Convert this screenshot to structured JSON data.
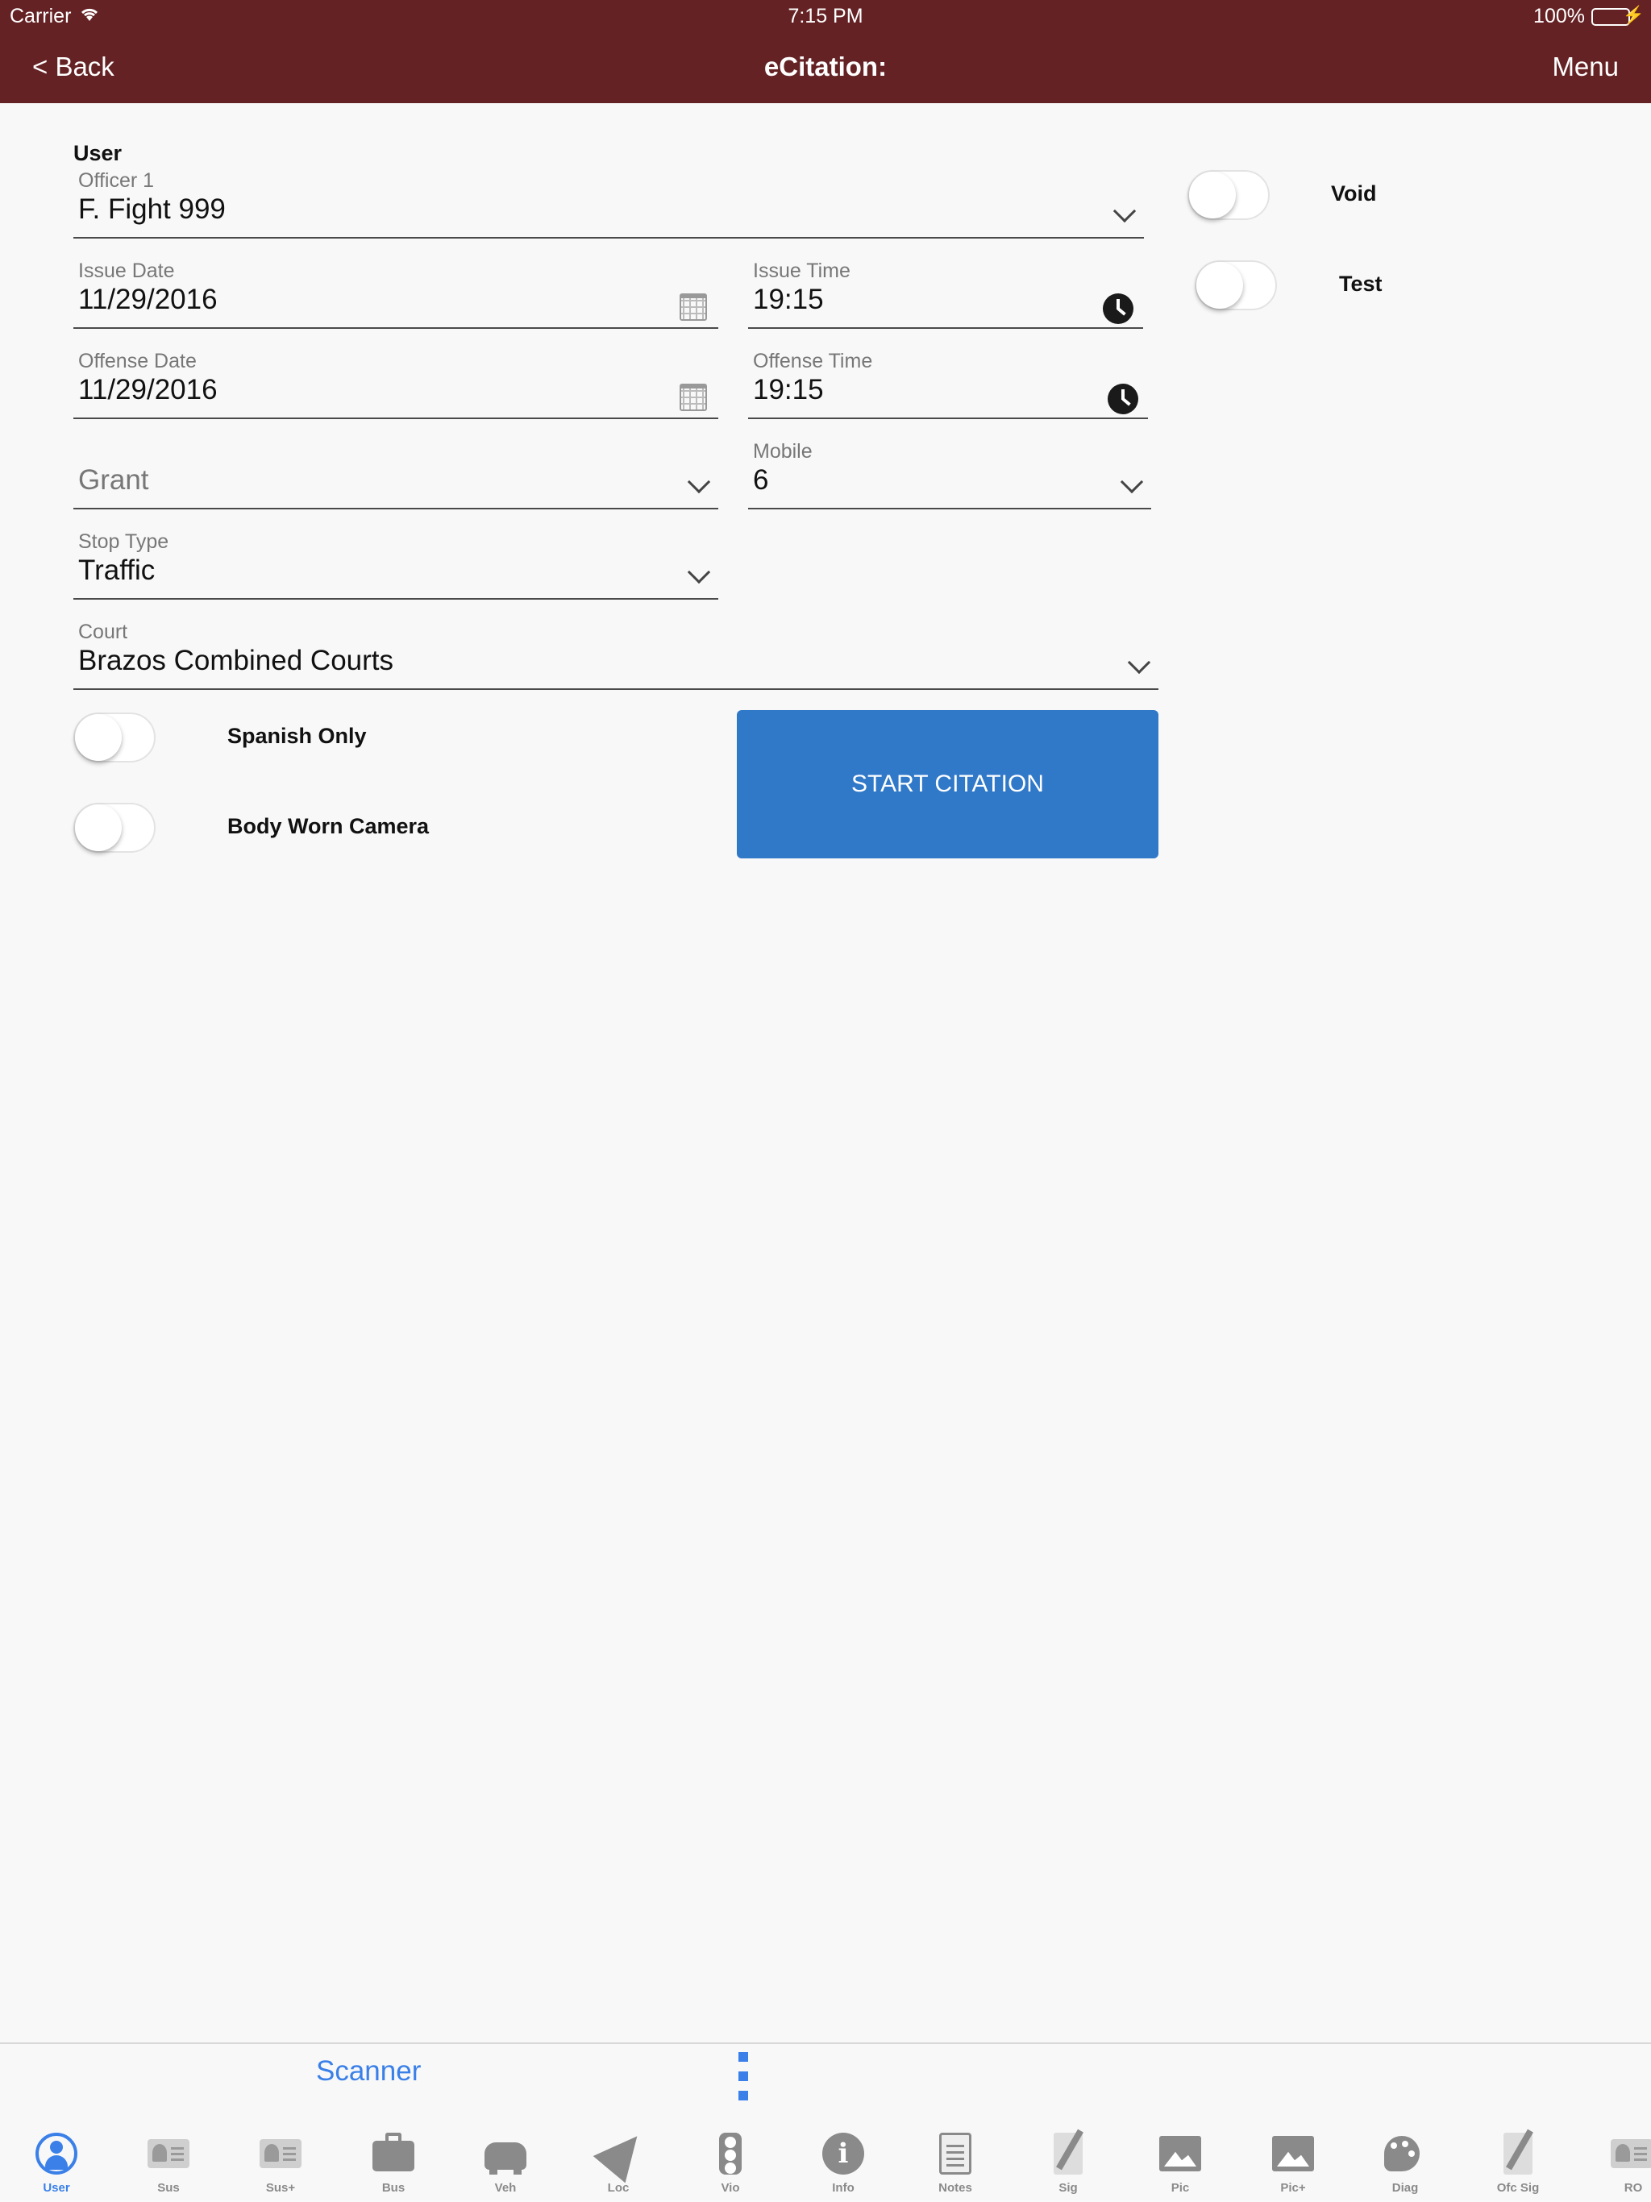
{
  "status_bar": {
    "carrier": "Carrier",
    "time": "7:15 PM",
    "battery": "100%"
  },
  "nav": {
    "back": "< Back",
    "title": "eCitation:",
    "menu": "Menu"
  },
  "form": {
    "section_title": "User",
    "officer": {
      "label": "Officer 1",
      "value": "F. Fight 999"
    },
    "issue_date": {
      "label": "Issue Date",
      "value": "11/29/2016"
    },
    "issue_time": {
      "label": "Issue Time",
      "value": "19:15"
    },
    "offense_date": {
      "label": "Offense Date",
      "value": "11/29/2016"
    },
    "offense_time": {
      "label": "Offense Time",
      "value": "19:15"
    },
    "grant": {
      "placeholder": "Grant"
    },
    "mobile": {
      "label": "Mobile",
      "value": "6"
    },
    "stop_type": {
      "label": "Stop Type",
      "value": "Traffic"
    },
    "court": {
      "label": "Court",
      "value": "Brazos Combined Courts"
    }
  },
  "toggles": {
    "void": {
      "label": "Void",
      "on": false
    },
    "test": {
      "label": "Test",
      "on": false
    },
    "spanish_only": {
      "label": "Spanish Only",
      "on": false
    },
    "body_worn_camera": {
      "label": "Body Worn Camera",
      "on": false
    }
  },
  "start_button": "START CITATION",
  "scanner": "Scanner",
  "tabs": [
    {
      "label": "User",
      "icon": "user-icon",
      "active": true
    },
    {
      "label": "Sus",
      "icon": "id-card-icon"
    },
    {
      "label": "Sus+",
      "icon": "id-card-icon"
    },
    {
      "label": "Bus",
      "icon": "briefcase-icon"
    },
    {
      "label": "Veh",
      "icon": "car-icon"
    },
    {
      "label": "Loc",
      "icon": "location-arrow-icon"
    },
    {
      "label": "Vio",
      "icon": "traffic-light-icon"
    },
    {
      "label": "Info",
      "icon": "info-icon"
    },
    {
      "label": "Notes",
      "icon": "notes-icon"
    },
    {
      "label": "Sig",
      "icon": "signature-icon"
    },
    {
      "label": "Pic",
      "icon": "picture-icon"
    },
    {
      "label": "Pic+",
      "icon": "picture-icon"
    },
    {
      "label": "Diag",
      "icon": "palette-icon"
    },
    {
      "label": "Ofc Sig",
      "icon": "signature-icon"
    },
    {
      "label": "RO",
      "icon": "id-card-icon"
    }
  ],
  "colors": {
    "header": "#652224",
    "accent": "#3078c8",
    "link": "#3a80e8"
  }
}
